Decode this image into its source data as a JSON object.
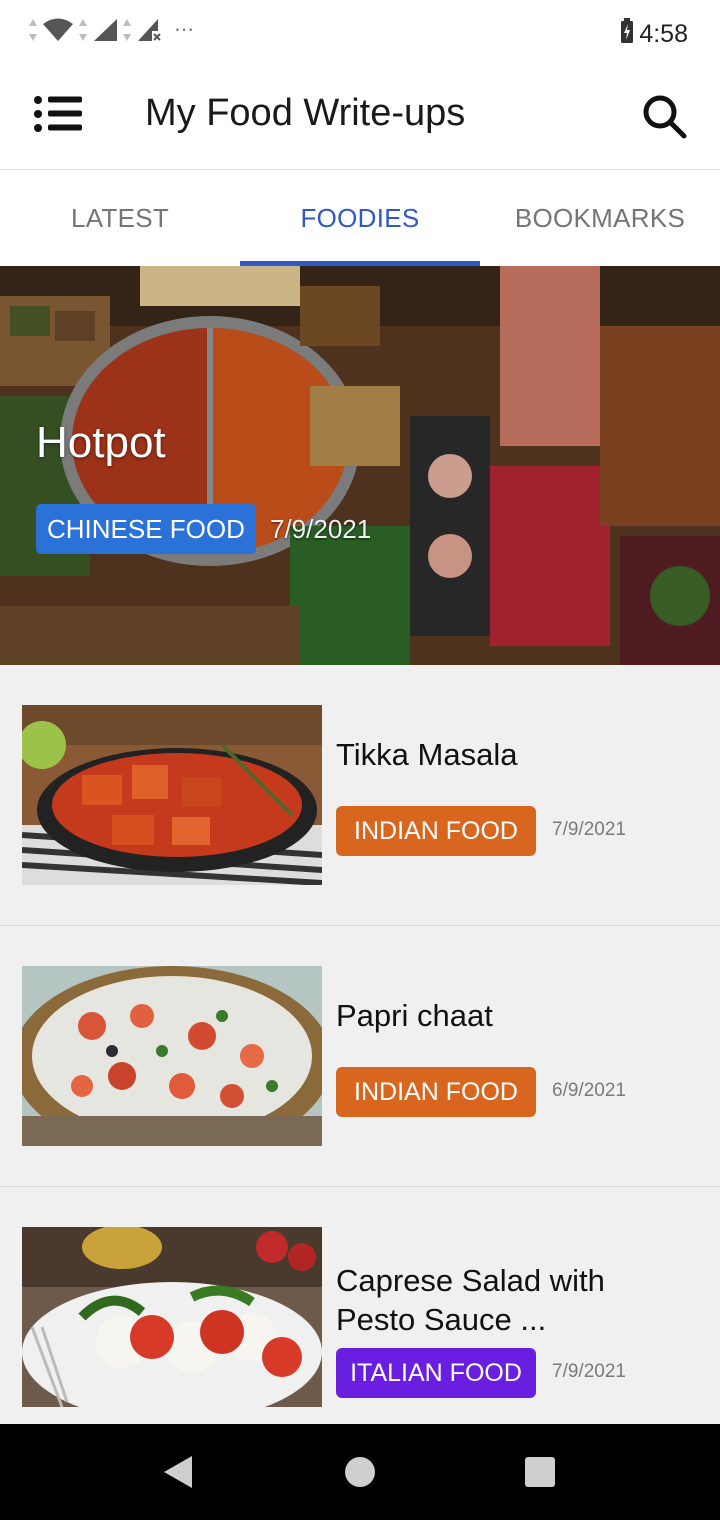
{
  "status_bar": {
    "time": "4:58",
    "icons": [
      "data-arrows-icon",
      "wifi-icon",
      "signal-icon",
      "signal-no-sim-icon",
      "more-notifications-icon"
    ],
    "battery_icon": "battery-charging-icon"
  },
  "app_bar": {
    "title": "My Food Write-ups",
    "menu_icon": "menu-icon",
    "search_icon": "search-icon"
  },
  "tabs": [
    {
      "label": "LATEST",
      "active": false
    },
    {
      "label": "FOODIES",
      "active": true
    },
    {
      "label": "BOOKMARKS",
      "active": false
    }
  ],
  "featured": {
    "title": "Hotpot",
    "category": "CHINESE FOOD",
    "date": "7/9/2021",
    "category_color": "#2a72d8"
  },
  "posts": [
    {
      "title": "Tikka Masala",
      "category": "INDIAN FOOD",
      "date": "7/9/2021",
      "category_color": "#d9661f"
    },
    {
      "title": "Papri chaat",
      "category": "INDIAN FOOD",
      "date": "6/9/2021",
      "category_color": "#d9661f"
    },
    {
      "title": "Caprese Salad with Pesto Sauce ...",
      "category": "ITALIAN FOOD",
      "date": "7/9/2021",
      "category_color": "#6a1fe0"
    }
  ],
  "nav_bar": {
    "icons": [
      "back-icon",
      "home-icon",
      "recents-icon"
    ]
  },
  "colors": {
    "accent": "#2f59c6",
    "tab_inactive": "#757575"
  }
}
